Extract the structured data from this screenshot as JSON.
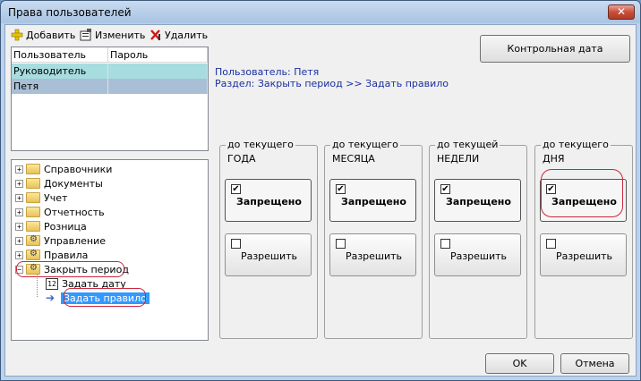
{
  "window": {
    "title": "Права пользователей",
    "close_glyph": "✕"
  },
  "toolbar": {
    "add": "Добавить",
    "edit": "Изменить",
    "delete": "Удалить"
  },
  "users": {
    "columns": [
      "Пользователь",
      "Пароль"
    ],
    "rows": [
      {
        "name": "Руководитель",
        "password": ""
      },
      {
        "name": "Петя",
        "password": ""
      }
    ]
  },
  "tree": {
    "items": [
      {
        "label": "Справочники",
        "icon": "folder-icon"
      },
      {
        "label": "Документы",
        "icon": "folder-icon"
      },
      {
        "label": "Учет",
        "icon": "folder-icon"
      },
      {
        "label": "Отчетность",
        "icon": "folder-icon"
      },
      {
        "label": "Розница",
        "icon": "folder-icon"
      },
      {
        "label": "Управление",
        "icon": "gear-folder-icon"
      },
      {
        "label": "Правила",
        "icon": "gear-folder-icon"
      },
      {
        "label": "Закрыть период",
        "icon": "gear-folder-icon"
      },
      {
        "label": "Задать дату",
        "icon": "date-icon"
      },
      {
        "label": "Задать правило",
        "icon": "arrow-icon"
      }
    ]
  },
  "header": {
    "user_line": "Пользователь:  Петя",
    "section_line": "Раздел:  Закрыть период >> Задать правило"
  },
  "control_date": "Контрольная дата",
  "groups": [
    {
      "top": "до текущего",
      "unit": "ГОДА",
      "deny": "Запрещено",
      "allow": "Разрешить",
      "deny_checked": true,
      "allow_checked": false
    },
    {
      "top": "до текущего",
      "unit": "МЕСЯЦА",
      "deny": "Запрещено",
      "allow": "Разрешить",
      "deny_checked": true,
      "allow_checked": false
    },
    {
      "top": "до текущей",
      "unit": "НЕДЕЛИ",
      "deny": "Запрещено",
      "allow": "Разрешить",
      "deny_checked": true,
      "allow_checked": false
    },
    {
      "top": "до текущего",
      "unit": "ДНЯ",
      "deny": "Запрещено",
      "allow": "Разрешить",
      "deny_checked": true,
      "allow_checked": false
    }
  ],
  "footer": {
    "ok": "OK",
    "cancel": "Отмена"
  },
  "colors": {
    "selected_row": "#a8dde0",
    "selected_row2": "#a9bfd6",
    "highlight": "#3399ff",
    "annotation": "#c8283c"
  }
}
